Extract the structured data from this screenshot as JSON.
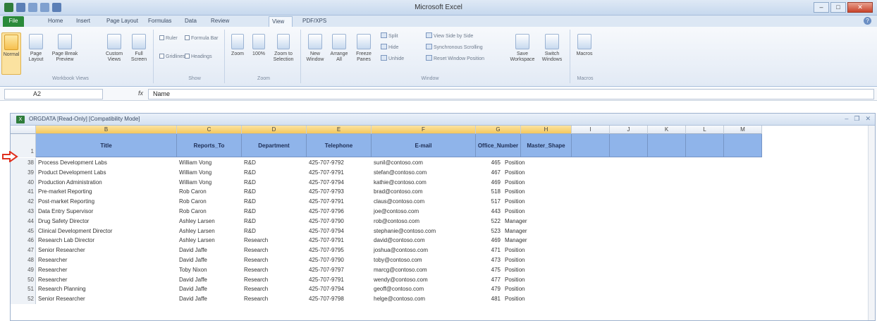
{
  "window": {
    "title": "Microsoft Excel"
  },
  "tabs": [
    "File",
    "Home",
    "Insert",
    "Page Layout",
    "Formulas",
    "Data",
    "Review",
    "View",
    "PDF/XPS"
  ],
  "ribbon": {
    "normal": "Normal",
    "page_layout": "Page Layout",
    "page_break": "Page Break Preview",
    "custom_views": "Custom Views",
    "full_screen": "Full Screen",
    "ruler": "Ruler",
    "formula_bar": "Formula Bar",
    "gridlines": "Gridlines",
    "headings": "Headings",
    "zoom": "Zoom",
    "zoom_100": "100%",
    "zoom_selection": "Zoom to Selection",
    "new_window": "New Window",
    "arrange_all": "Arrange All",
    "freeze_panes": "Freeze Panes",
    "split": "Split",
    "hide": "Hide",
    "unhide": "Unhide",
    "view_side": "View Side by Side",
    "sync_scroll": "Synchronous Scrolling",
    "reset_pos": "Reset Window Position",
    "save_workspace": "Save Workspace",
    "switch_windows": "Switch Windows",
    "macros": "Macros",
    "groups": {
      "workbook_views": "Workbook Views",
      "show": "Show",
      "zoom": "Zoom",
      "window": "Window",
      "macros": "Macros"
    }
  },
  "formula_bar": {
    "name_box": "A2",
    "fx": "fx",
    "content": "Name"
  },
  "workbook": {
    "title": "ORGDATA [Read-Only] [Compatibility Mode]",
    "column_letters": [
      "B",
      "C",
      "D",
      "E",
      "F",
      "G",
      "H",
      "I",
      "J",
      "K",
      "L",
      "M"
    ],
    "header_row_number": "1",
    "headers": [
      "Title",
      "Reports_To",
      "Department",
      "Telephone",
      "E-mail",
      "Office_Number",
      "Master_Shape"
    ],
    "rows": [
      {
        "num": "38",
        "title": "Process Development Labs",
        "reports_to": "William Vong",
        "dept": "R&D",
        "tel": "425-707-9792",
        "email": "sunil@contoso.com",
        "office": "465",
        "shape": "Position"
      },
      {
        "num": "39",
        "title": "Product Development Labs",
        "reports_to": "William Vong",
        "dept": "R&D",
        "tel": "425-707-9791",
        "email": "stefan@contoso.com",
        "office": "467",
        "shape": "Position"
      },
      {
        "num": "40",
        "title": "Production Administration",
        "reports_to": "William Vong",
        "dept": "R&D",
        "tel": "425-707-9794",
        "email": "kathie@contoso.com",
        "office": "469",
        "shape": "Position"
      },
      {
        "num": "41",
        "title": "Pre-market Reporting",
        "reports_to": "Rob Caron",
        "dept": "R&D",
        "tel": "425-707-9793",
        "email": "brad@contoso.com",
        "office": "518",
        "shape": "Position"
      },
      {
        "num": "42",
        "title": "Post-market Reporting",
        "reports_to": "Rob Caron",
        "dept": "R&D",
        "tel": "425-707-9791",
        "email": "claus@contoso.com",
        "office": "517",
        "shape": "Position"
      },
      {
        "num": "43",
        "title": "Data Entry Supervisor",
        "reports_to": "Rob Caron",
        "dept": "R&D",
        "tel": "425-707-9796",
        "email": "joe@contoso.com",
        "office": "443",
        "shape": "Position"
      },
      {
        "num": "44",
        "title": "Drug Safety Director",
        "reports_to": "Ashley Larsen",
        "dept": "R&D",
        "tel": "425-707-9790",
        "email": "rob@contoso.com",
        "office": "522",
        "shape": "Manager"
      },
      {
        "num": "45",
        "title": "Clinical Development Director",
        "reports_to": "Ashley Larsen",
        "dept": "R&D",
        "tel": "425-707-9794",
        "email": "stephanie@contoso.com",
        "office": "523",
        "shape": "Manager"
      },
      {
        "num": "46",
        "title": "Research Lab Director",
        "reports_to": "Ashley Larsen",
        "dept": "Research",
        "tel": "425-707-9791",
        "email": "david@contoso.com",
        "office": "469",
        "shape": "Manager"
      },
      {
        "num": "47",
        "title": "Senior Researcher",
        "reports_to": "David Jaffe",
        "dept": "Research",
        "tel": "425-707-9795",
        "email": "joshua@contoso.com",
        "office": "471",
        "shape": "Position"
      },
      {
        "num": "48",
        "title": "Researcher",
        "reports_to": "David Jaffe",
        "dept": "Research",
        "tel": "425-707-9790",
        "email": "toby@contoso.com",
        "office": "473",
        "shape": "Position"
      },
      {
        "num": "49",
        "title": "Researcher",
        "reports_to": "Toby Nixon",
        "dept": "Research",
        "tel": "425-707-9797",
        "email": "marcg@contoso.com",
        "office": "475",
        "shape": "Position"
      },
      {
        "num": "50",
        "title": "Researcher",
        "reports_to": "David Jaffe",
        "dept": "Research",
        "tel": "425-707-9791",
        "email": "wendy@contoso.com",
        "office": "477",
        "shape": "Position"
      },
      {
        "num": "51",
        "title": "Research Planning",
        "reports_to": "David Jaffe",
        "dept": "Research",
        "tel": "425-707-9794",
        "email": "geoff@contoso.com",
        "office": "479",
        "shape": "Position"
      },
      {
        "num": "52",
        "title": "Senior Researcher",
        "reports_to": "David Jaffe",
        "dept": "Research",
        "tel": "425-707-9798",
        "email": "helge@contoso.com",
        "office": "481",
        "shape": "Position"
      }
    ]
  },
  "colors": {
    "header_fill": "#8fb4ea",
    "file_tab": "#2a8a3a",
    "arrow": "#e0301e"
  }
}
